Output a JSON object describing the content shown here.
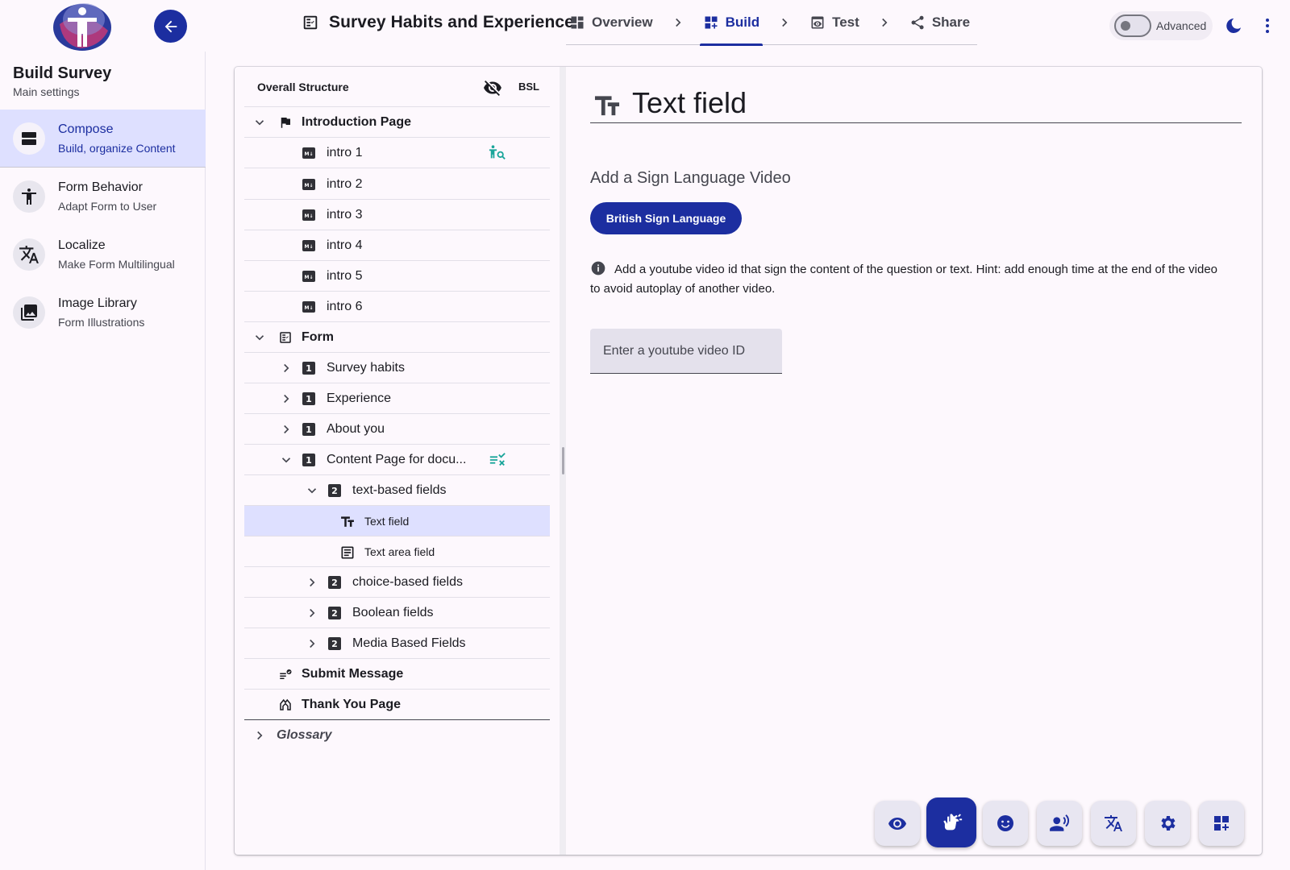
{
  "header": {
    "survey_title": "Survey Habits and Experience",
    "steps": [
      {
        "label": "Overview",
        "icon": "dashboard-icon"
      },
      {
        "label": "Build",
        "icon": "add-grid-icon",
        "active": true
      },
      {
        "label": "Test",
        "icon": "preview-icon"
      },
      {
        "label": "Share",
        "icon": "share-icon"
      }
    ],
    "advanced_label": "Advanced",
    "advanced_on": false
  },
  "sidebar": {
    "title": "Build Survey",
    "subtitle": "Main settings",
    "items": [
      {
        "label": "Compose",
        "desc": "Build, organize Content",
        "icon": "view-agenda-icon",
        "active": true
      },
      {
        "label": "Form Behavior",
        "desc": "Adapt Form to User",
        "icon": "accessibility-icon"
      },
      {
        "label": "Localize",
        "desc": "Make Form Multilingual",
        "icon": "translate-icon"
      },
      {
        "label": "Image Library",
        "desc": "Form Illustrations",
        "icon": "photo-library-icon"
      }
    ]
  },
  "tree": {
    "heading": "Overall Structure",
    "bsl_label": "BSL",
    "rows": [
      {
        "label": "Introduction Page",
        "level": 0,
        "expanded": true,
        "icon": "flag-icon",
        "bold": true
      },
      {
        "label": "intro 1",
        "level": 1,
        "icon": "markdown-icon",
        "action": "accessibility-search-icon"
      },
      {
        "label": "intro 2",
        "level": 1,
        "icon": "markdown-icon"
      },
      {
        "label": "intro 3",
        "level": 1,
        "icon": "markdown-icon"
      },
      {
        "label": "intro 4",
        "level": 1,
        "icon": "markdown-icon"
      },
      {
        "label": "intro 5",
        "level": 1,
        "icon": "markdown-icon"
      },
      {
        "label": "intro 6",
        "level": 1,
        "icon": "markdown-icon"
      },
      {
        "label": "Form",
        "level": 0,
        "expanded": true,
        "icon": "form-icon",
        "bold": true
      },
      {
        "label": "Survey habits",
        "level": 1,
        "expanded": false,
        "badge": "1"
      },
      {
        "label": "Experience",
        "level": 1,
        "expanded": false,
        "badge": "1"
      },
      {
        "label": "About you",
        "level": 1,
        "expanded": false,
        "badge": "1"
      },
      {
        "label": "Content Page for docu...",
        "level": 1,
        "expanded": true,
        "badge": "1",
        "action": "rule-icon"
      },
      {
        "label": "text-based fields",
        "level": 2,
        "expanded": true,
        "badge": "2"
      },
      {
        "label": "Text field",
        "level": 3,
        "icon": "text-fields-icon",
        "selected": true
      },
      {
        "label": "Text area field",
        "level": 3,
        "icon": "text-area-icon"
      },
      {
        "label": "choice-based fields",
        "level": 2,
        "expanded": false,
        "badge": "2"
      },
      {
        "label": "Boolean fields",
        "level": 2,
        "expanded": false,
        "badge": "2"
      },
      {
        "label": "Media Based Fields",
        "level": 2,
        "expanded": false,
        "badge": "2"
      },
      {
        "label": "Submit Message",
        "level": 0,
        "icon": "submit-message-icon",
        "bold": true
      },
      {
        "label": "Thank You Page",
        "level": 0,
        "icon": "thank-you-icon",
        "bold": true
      },
      {
        "label": "Glossary",
        "level": 0,
        "expanded": false,
        "italic": true
      }
    ]
  },
  "editor": {
    "title": "Text field",
    "section_heading": "Add a Sign Language Video",
    "bsl_button": "British Sign Language",
    "info_text": "Add a youtube video id that sign the content of the question or text. Hint: add enough time at the end of the video to avoid autoplay of another video.",
    "video_id_placeholder": "Enter a youtube video ID",
    "video_id_value": ""
  },
  "action_bar": [
    {
      "name": "preview-action",
      "icon": "eye-icon"
    },
    {
      "name": "sign-language-action",
      "icon": "sign-language-icon",
      "active": true
    },
    {
      "name": "emoji-action",
      "icon": "emoji-icon"
    },
    {
      "name": "audio-action",
      "icon": "record-voice-icon"
    },
    {
      "name": "translate-action",
      "icon": "translate-icon"
    },
    {
      "name": "settings-action",
      "icon": "gear-icon"
    },
    {
      "name": "add-action",
      "icon": "add-grid-icon"
    }
  ],
  "colors": {
    "primary": "#1c2ea0",
    "selected_bg": "#dee0ff",
    "teal_action": "#1aa59a",
    "background": "#fdf8fd"
  }
}
